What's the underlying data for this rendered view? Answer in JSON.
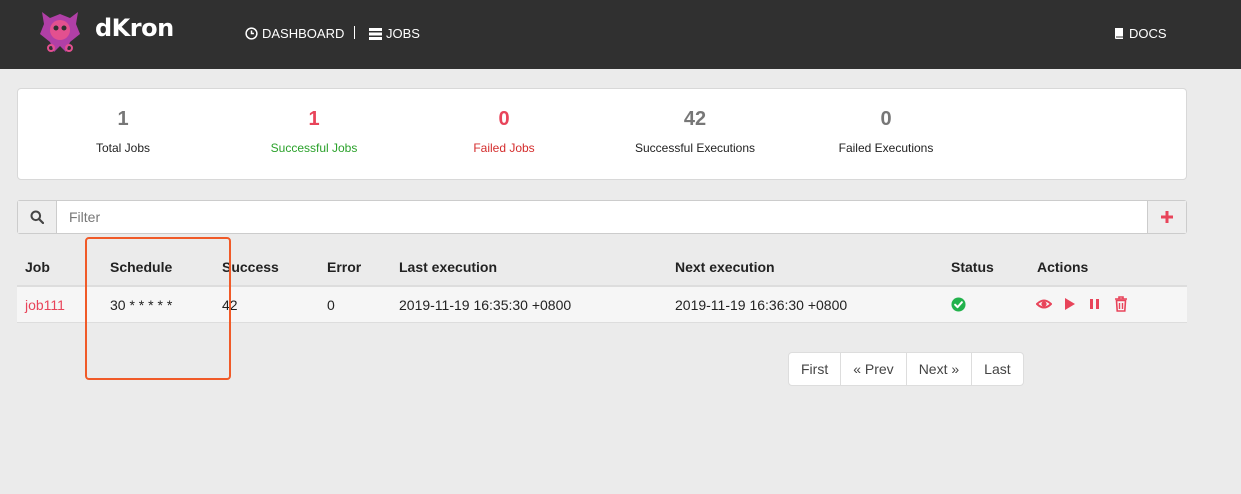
{
  "navbar": {
    "brand": "dKron",
    "logo_icon": "octopus-logo-icon",
    "links": [
      {
        "label": "DASHBOARD",
        "icon": "clock-icon"
      },
      {
        "label": "JOBS",
        "icon": "list-icon"
      },
      {
        "label": "DOCS",
        "icon": "book-icon"
      }
    ]
  },
  "stats": [
    {
      "value": "1",
      "label": "Total Jobs"
    },
    {
      "value": "1",
      "label": "Successful Jobs"
    },
    {
      "value": "0",
      "label": "Failed Jobs"
    },
    {
      "value": "42",
      "label": "Successful Executions"
    },
    {
      "value": "0",
      "label": "Failed Executions"
    }
  ],
  "filter": {
    "placeholder": "Filter",
    "search_icon": "search-icon",
    "add_icon": "plus-icon"
  },
  "table": {
    "headers": [
      "Job",
      "Schedule",
      "Success",
      "Error",
      "Last execution",
      "Next execution",
      "Status",
      "Actions"
    ],
    "rows": [
      {
        "job": "job111",
        "schedule": "30 * * * * *",
        "success": "42",
        "error": "0",
        "last_execution": "2019-11-19 16:35:30 +0800",
        "next_execution": "2019-11-19 16:36:30 +0800",
        "status_icon": "check-circle-icon",
        "actions": [
          "eye-icon",
          "play-icon",
          "pause-icon",
          "trash-icon"
        ]
      }
    ]
  },
  "pagination": [
    "First",
    "« Prev",
    "Next »",
    "Last"
  ],
  "colors": {
    "navbar": "#303030",
    "accent": "#e8445a",
    "success": "#2aa12a",
    "status_ok": "#22b24c",
    "highlight": "#f05a28"
  }
}
